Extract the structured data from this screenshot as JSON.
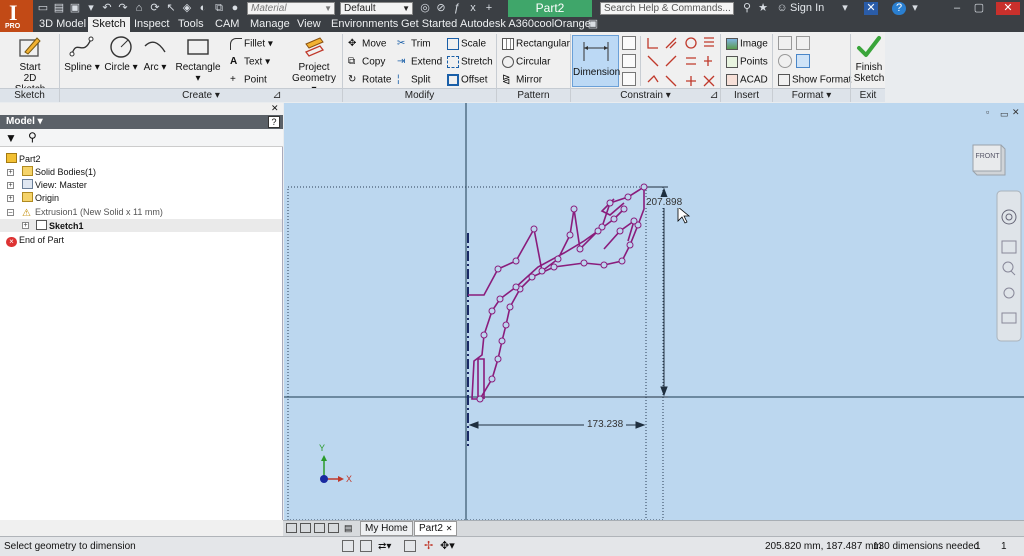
{
  "app": {
    "logo_letter": "I",
    "logo_edition": "PRO",
    "material_placeholder": "Material",
    "appearance_value": "Default",
    "doc_title": "Part2",
    "help_search_placeholder": "Search Help & Commands...",
    "sign_in": "Sign In"
  },
  "menu_tabs": [
    "3D Model",
    "Sketch",
    "Inspect",
    "Tools",
    "CAM",
    "Manage",
    "View",
    "Environments",
    "Get Started",
    "Autodesk A360",
    "coolOrange"
  ],
  "active_tab": "Sketch",
  "ribbon": {
    "sketch_group": {
      "start_sketch": "Start",
      "start_sketch_2": "2D Sketch",
      "footer": "Sketch"
    },
    "create_group": {
      "spline": "Spline",
      "circle": "Circle",
      "arc": "Arc",
      "rectangle": "Rectangle",
      "fillet": "Fillet",
      "text": "Text",
      "point": "Point",
      "project_geometry": "Project",
      "project_geometry_2": "Geometry",
      "footer": "Create"
    },
    "modify_group": {
      "move": "Move",
      "copy": "Copy",
      "rotate": "Rotate",
      "trim": "Trim",
      "extend": "Extend",
      "split": "Split",
      "scale": "Scale",
      "stretch": "Stretch",
      "offset": "Offset",
      "footer": "Modify"
    },
    "pattern_group": {
      "rectangular": "Rectangular",
      "circular": "Circular",
      "mirror": "Mirror",
      "footer": "Pattern"
    },
    "constrain_group": {
      "dimension": "Dimension",
      "footer": "Constrain"
    },
    "insert_group": {
      "image": "Image",
      "points": "Points",
      "acad": "ACAD",
      "footer": "Insert"
    },
    "format_group": {
      "show_format": "Show Format",
      "footer": "Format"
    },
    "exit_group": {
      "finish": "Finish",
      "finish_2": "Sketch",
      "footer": "Exit"
    }
  },
  "browser": {
    "title": "Model",
    "tree": [
      {
        "label": "Part2",
        "icon": "part-icon",
        "level": 0
      },
      {
        "label": "Solid Bodies(1)",
        "icon": "folder-icon",
        "level": 1
      },
      {
        "label": "View: Master",
        "icon": "view-icon",
        "level": 1
      },
      {
        "label": "Origin",
        "icon": "folder-icon",
        "level": 1
      },
      {
        "label": "Extrusion1 (New Solid x 11 mm)",
        "icon": "warning-icon",
        "level": 1
      },
      {
        "label": "Sketch1",
        "icon": "sketch-icon",
        "level": 2
      },
      {
        "label": "End of Part",
        "icon": "end-of-part-icon",
        "level": 1
      }
    ]
  },
  "canvas": {
    "dimension_vertical": "207.898",
    "dimension_horizontal": "173.238",
    "viewcube_label": "FRONT",
    "triad_x": "X",
    "triad_y": "Y"
  },
  "doc_tabs": [
    "My Home",
    "Part2"
  ],
  "status": {
    "prompt": "Select geometry to dimension",
    "coords": "205.820 mm, 187.487 mm",
    "dims_needed": "130 dimensions needed",
    "count_a": "1",
    "count_b": "1"
  },
  "colors": {
    "sketch_geometry": "#8a1c7c",
    "canvas_bg": "#bcd7ef",
    "accent_green": "#3fa66a",
    "logo_orange": "#c24a16"
  }
}
